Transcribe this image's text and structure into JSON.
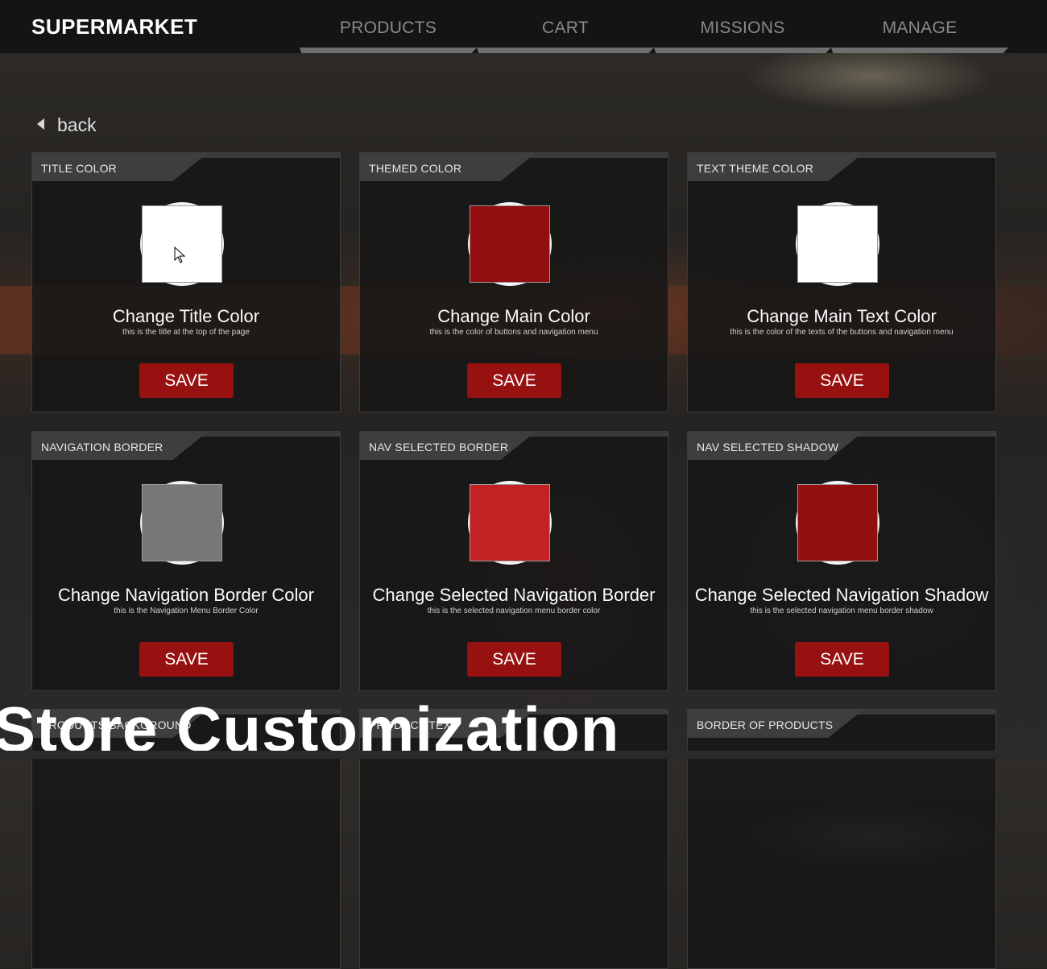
{
  "app": {
    "brand": "SUPERMARKET"
  },
  "nav": {
    "tabs": [
      {
        "label": "PRODUCTS"
      },
      {
        "label": "CART"
      },
      {
        "label": "MISSIONS"
      },
      {
        "label": "MANAGE"
      }
    ]
  },
  "back": {
    "label": "back",
    "icon": "caret-left-icon"
  },
  "theme": {
    "accent": "#981111",
    "nav_border": "#6e6e6e",
    "card_bg": "#161616"
  },
  "cards": [
    {
      "title": "TITLE COLOR",
      "heading": "Change Title Color",
      "description": "this is the title at the top of the page",
      "swatch_color": "#ffffff",
      "save_label": "SAVE"
    },
    {
      "title": "THEMED COLOR",
      "heading": "Change Main Color",
      "description": "this is the color of buttons and navigation menu",
      "swatch_color": "#930e0e",
      "save_label": "SAVE"
    },
    {
      "title": "TEXT THEME COLOR",
      "heading": "Change Main Text Color",
      "description": "this is the color of the texts of the buttons and navigation menu",
      "swatch_color": "#ffffff",
      "save_label": "SAVE"
    },
    {
      "title": "NAVIGATION BORDER",
      "heading": "Change Navigation Border Color",
      "description": "this is the Navigation Menu Border Color",
      "swatch_color": "#777777",
      "save_label": "SAVE"
    },
    {
      "title": "NAV SELECTED BORDER",
      "heading": "Change Selected Navigation Border",
      "description": "this is the selected navigation menu border color",
      "swatch_color": "#c42222",
      "save_label": "SAVE"
    },
    {
      "title": "NAV SELECTED SHADOW",
      "heading": "Change Selected Navigation Shadow",
      "description": "this is the selected navigation menu border shadow",
      "swatch_color": "#930e0e",
      "save_label": "SAVE"
    },
    {
      "title": "PRODUCTS BACKGROUND"
    },
    {
      "title": "PRODUCT TEXT"
    },
    {
      "title": "BORDER OF PRODUCTS"
    }
  ],
  "page": {
    "title": "Store Customization"
  }
}
